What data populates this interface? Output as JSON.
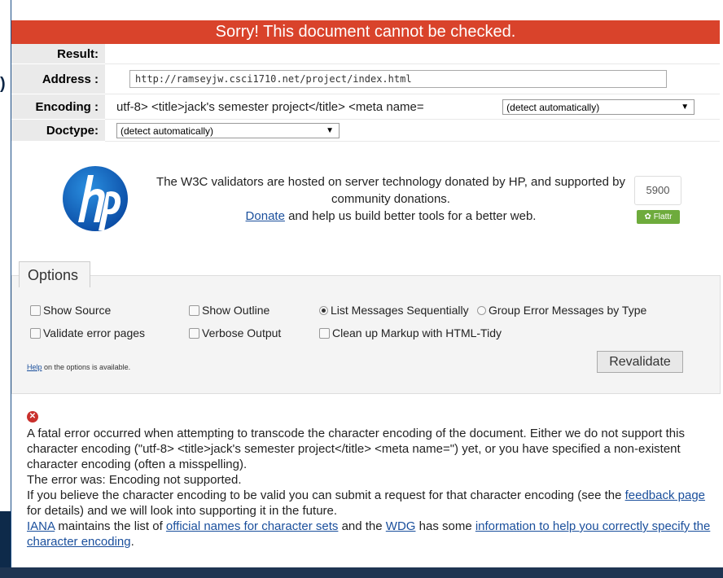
{
  "banner": "Sorry! This document cannot be checked.",
  "meta": {
    "result_label": "Result:",
    "result_value": "",
    "address_label": "Address :",
    "address_value": "http://ramseyjw.csci1710.net/project/index.html",
    "encoding_label": "Encoding :",
    "encoding_value": "utf-8> <title>jack's semester project</title> <meta name=",
    "encoding_select": "(detect automatically)",
    "doctype_label": "Doctype:",
    "doctype_select": "(detect automatically)"
  },
  "sponsor": {
    "text": "The W3C validators are hosted on server technology donated by HP, and supported by community donations.",
    "donate_link": "Donate",
    "donate_rest": " and help us build better tools for a better web.",
    "flattr_count": "5900",
    "flattr_label": "Flattr"
  },
  "options": {
    "legend": "Options",
    "show_source": "Show Source",
    "show_outline": "Show Outline",
    "list_sequential": "List Messages Sequentially",
    "group_by_type": "Group Error Messages by Type",
    "validate_error_pages": "Validate error pages",
    "verbose_output": "Verbose Output",
    "clean_up": "Clean up Markup with HTML-Tidy",
    "help_link": "Help",
    "help_rest": " on the options is available.",
    "revalidate": "Revalidate"
  },
  "error": {
    "paragraph1": "A fatal error occurred when attempting to transcode the character encoding of the document. Either we do not support this character encoding (\"utf-8> <title>jack's semester project</title> <meta name=\") yet, or you have specified a non-existent character encoding (often a misspelling).",
    "paragraph2": "The error was: Encoding not supported.",
    "paragraph3_pre": "If you believe the character encoding to be valid you can submit a request for that character encoding (see the ",
    "feedback_link": "feedback page",
    "paragraph3_post": " for details) and we will look into supporting it in the future.",
    "iana_link": "IANA",
    "p4_a": " maintains the list of ",
    "official_names_link": "official names for character sets",
    "p4_b": " and the ",
    "wdg_link": "WDG",
    "p4_c": " has some ",
    "info_link": "information to help you correctly specify the character encoding",
    "p4_d": "."
  },
  "colors": {
    "banner": "#d9432b",
    "link": "#1a4f9c",
    "flattr": "#6eab3c"
  }
}
